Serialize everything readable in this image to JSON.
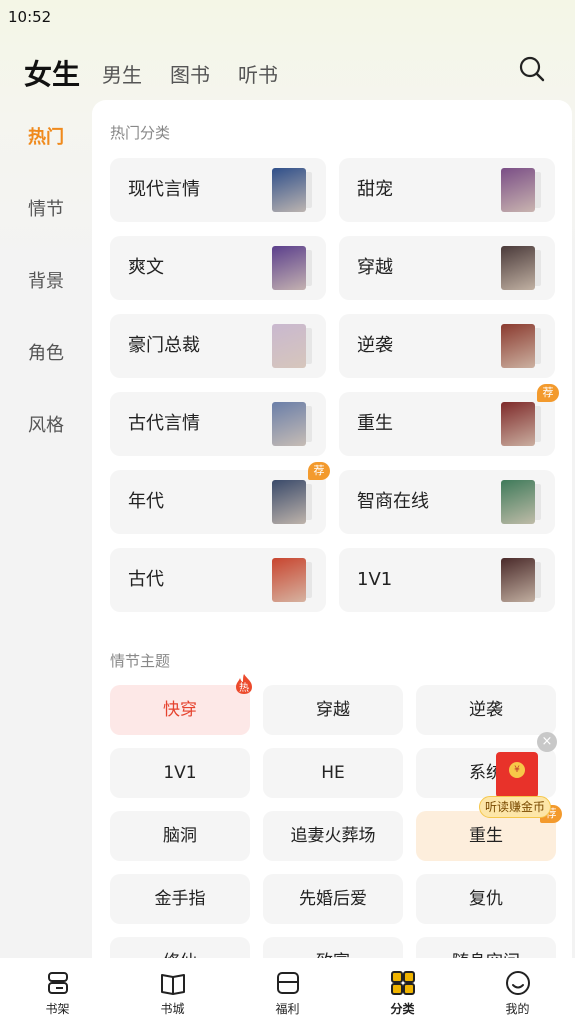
{
  "status": {
    "time": "10:52"
  },
  "top_tabs": [
    {
      "label": "女生",
      "active": true
    },
    {
      "label": "男生"
    },
    {
      "label": "图书"
    },
    {
      "label": "听书"
    }
  ],
  "side_menu": [
    {
      "label": "热门",
      "active": true
    },
    {
      "label": "情节"
    },
    {
      "label": "背景"
    },
    {
      "label": "角色"
    },
    {
      "label": "风格"
    }
  ],
  "hot_categories": {
    "title": "热门分类",
    "items": [
      {
        "label": "现代言情",
        "badge": "",
        "cover_color": "#2f4f8a"
      },
      {
        "label": "甜宠",
        "badge": "",
        "cover_color": "#7a4e86"
      },
      {
        "label": "爽文",
        "badge": "",
        "cover_color": "#5b3f8c"
      },
      {
        "label": "穿越",
        "badge": "",
        "cover_color": "#4a3a3a"
      },
      {
        "label": "豪门总裁",
        "badge": "",
        "cover_color": "#c9b8cf"
      },
      {
        "label": "逆袭",
        "badge": "",
        "cover_color": "#8a3a2f"
      },
      {
        "label": "古代言情",
        "badge": "",
        "cover_color": "#6a7ea8"
      },
      {
        "label": "重生",
        "badge": "荐",
        "cover_color": "#7e2a2a"
      },
      {
        "label": "年代",
        "badge": "荐",
        "cover_color": "#3a4a6a"
      },
      {
        "label": "智商在线",
        "badge": "",
        "cover_color": "#3f7a5a"
      },
      {
        "label": "古代",
        "badge": "",
        "cover_color": "#c8452f"
      },
      {
        "label": "1V1",
        "badge": "",
        "cover_color": "#4a2a2a"
      }
    ]
  },
  "plot_themes": {
    "title": "情节主题",
    "items": [
      {
        "label": "快穿",
        "style": "hot",
        "badge": "热"
      },
      {
        "label": "穿越",
        "style": "",
        "badge": ""
      },
      {
        "label": "逆袭",
        "style": "",
        "badge": ""
      },
      {
        "label": "1V1",
        "style": "",
        "badge": ""
      },
      {
        "label": "HE",
        "style": "",
        "badge": ""
      },
      {
        "label": "系统",
        "style": "",
        "badge": ""
      },
      {
        "label": "脑洞",
        "style": "",
        "badge": ""
      },
      {
        "label": "追妻火葬场",
        "style": "",
        "badge": ""
      },
      {
        "label": "重生",
        "style": "warm",
        "badge": "荐"
      },
      {
        "label": "金手指",
        "style": "",
        "badge": ""
      },
      {
        "label": "先婚后爱",
        "style": "",
        "badge": ""
      },
      {
        "label": "复仇",
        "style": "",
        "badge": ""
      },
      {
        "label": "修仙",
        "style": "",
        "badge": ""
      },
      {
        "label": "致富",
        "style": "",
        "badge": ""
      },
      {
        "label": "随身空间",
        "style": "",
        "badge": ""
      }
    ]
  },
  "floating_promo": {
    "close": "×",
    "coin": "¥",
    "label": "听读赚金币"
  },
  "bottom_nav": [
    {
      "label": "书架",
      "icon": "bookshelf-icon"
    },
    {
      "label": "书城",
      "icon": "open-book-icon"
    },
    {
      "label": "福利",
      "icon": "wallet-icon"
    },
    {
      "label": "分类",
      "icon": "grid-icon",
      "active": true
    },
    {
      "label": "我的",
      "icon": "smile-icon"
    }
  ],
  "colors": {
    "accent": "#f08a1c",
    "hot": "#e5432f",
    "badge": "#f39a2d",
    "nav_active": "#f0b400"
  }
}
